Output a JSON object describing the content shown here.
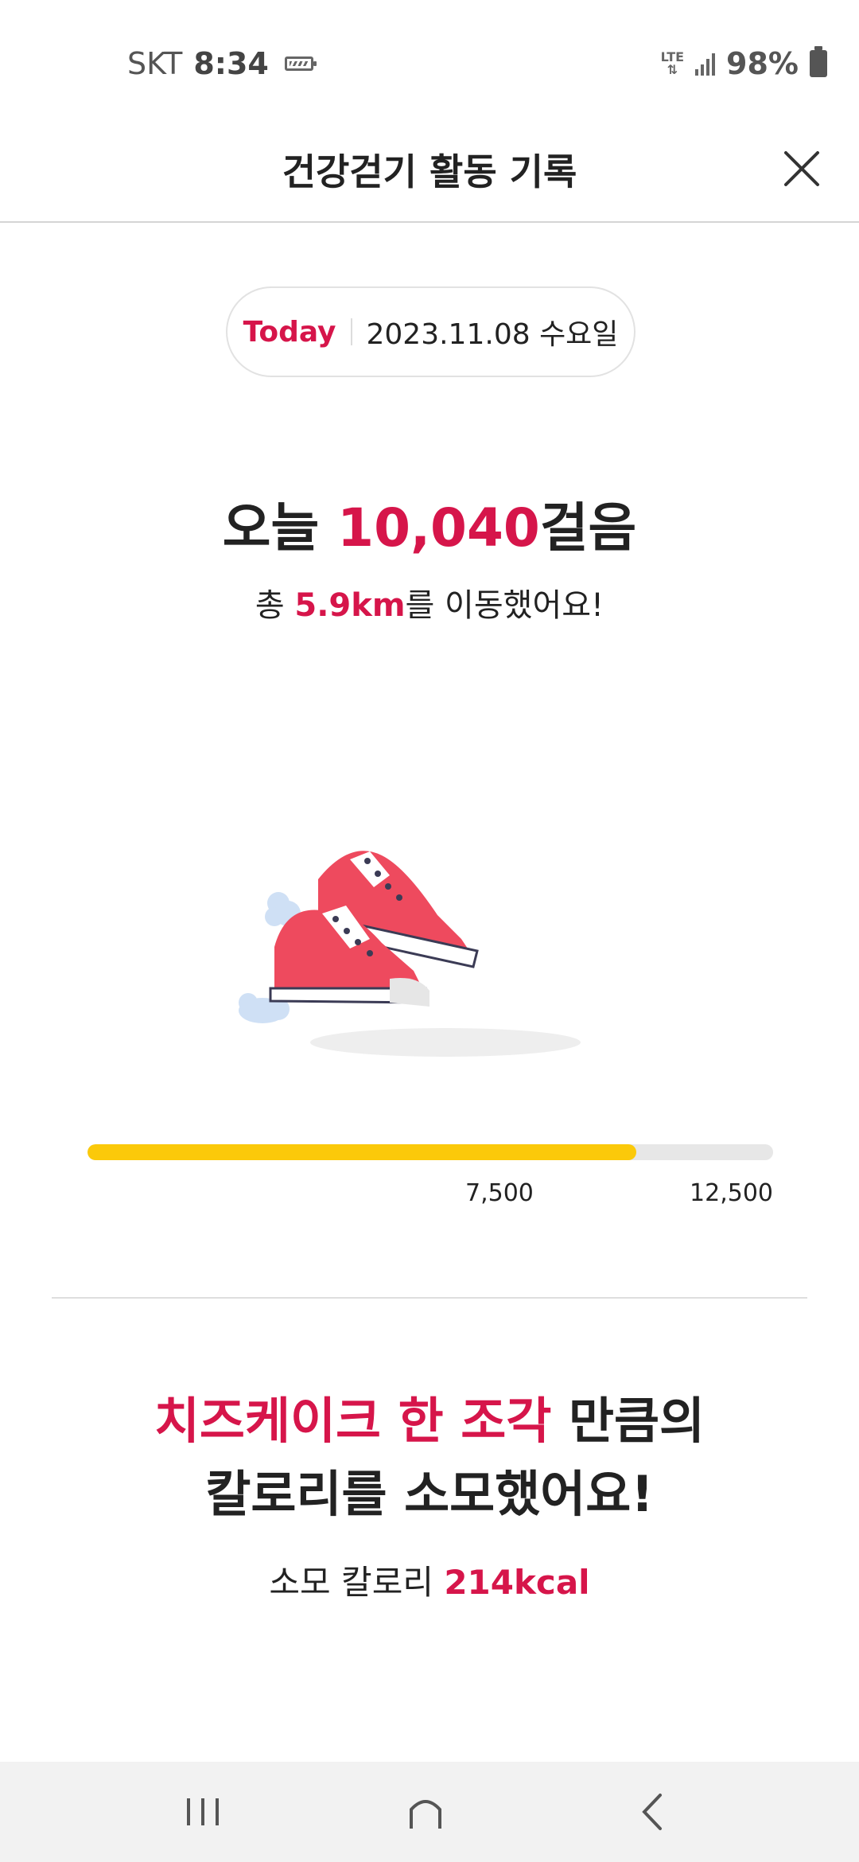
{
  "status_bar": {
    "carrier": "SKT",
    "time": "8:34",
    "network": "LTE",
    "battery": "98%"
  },
  "header": {
    "title": "건강걷기 활동 기록"
  },
  "date_pill": {
    "today_label": "Today",
    "date": "2023.11.08 수요일"
  },
  "steps": {
    "prefix": "오늘 ",
    "count": "10,040",
    "suffix": "걸음"
  },
  "distance": {
    "prefix": "총 ",
    "value": "5.9km",
    "suffix": "를 이동했어요!"
  },
  "progress": {
    "fraction": 0.8,
    "mid_label": "7,500",
    "max_label": "12,500",
    "fill_color": "#fbc90a",
    "track_color": "#e7e7e7"
  },
  "calories": {
    "food_highlight": "치즈케이크 한 조각",
    "line1_suffix": " 만큼의",
    "line2": "칼로리를 소모했어요!",
    "sub_prefix": "소모 칼로리 ",
    "sub_value": "214kcal"
  },
  "colors": {
    "accent": "#d6154a",
    "shoe": "#ee4a5e"
  },
  "icons": {
    "close": "close-icon",
    "recents": "recents-icon",
    "home": "home-icon",
    "back": "back-icon",
    "illustration": "sneakers-illustration"
  }
}
